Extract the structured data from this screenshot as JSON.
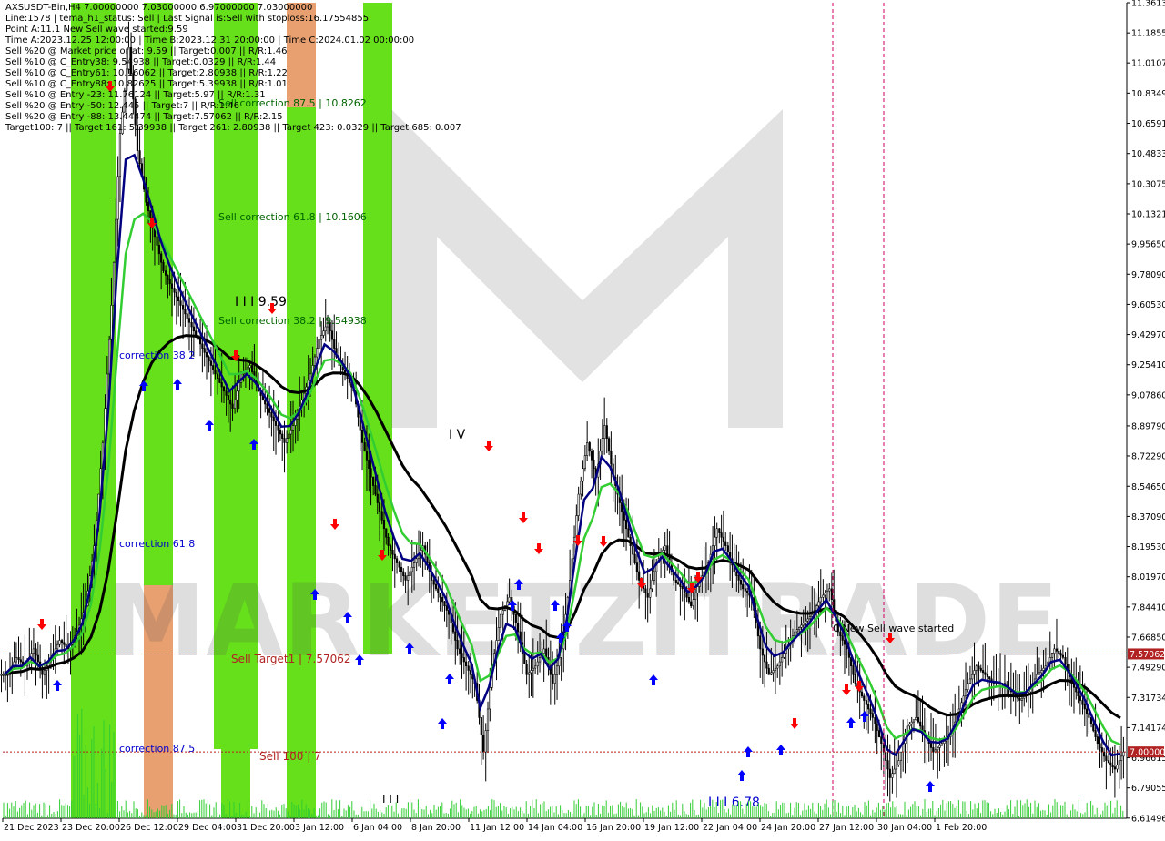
{
  "info_lines": [
    "AXSUSDT-Bin,H4  7.00000000 7.03000000 6.97000000 7.03000000",
    "Line:1578 | tema_h1_status: Sell | Last Signal is:Sell with stoploss:16.17554855",
    "Point A:11.1 New Sell wave started:9.59",
    "Time A:2023.12.25 12:00:00 | Time B:2023.12.31 20:00:00 | Time C:2024.01.02 00:00:00",
    "Sell %20 @ Market price or at: 9.59 || Target:0.007 || R/R:1.46",
    "Sell %10 @ C_Entry38: 9.54938 || Target:0.0329 || R/R:1.44",
    "Sell %10 @ C_Entry61: 10.16062 || Target:2.80938 || R/R:1.22",
    "Sell %10 @ C_Entry88: 10.82625 || Target:5.39938 || R/R:1.01",
    "Sell %10 @ Entry -23: 11.76124 || Target:5.97 || R/R:1.31",
    "Sell %20 @ Entry -50: 12.445 || Target:7 || R/R:1.46",
    "Sell %20 @ Entry -88: 13.44474 || Target:7.57062 || R/R:2.15",
    "Target100: 7 || Target 161: 5.39938 || Target 261: 2.80938 || Target 423: 0.0329 || Target 685: 0.007"
  ],
  "watermark": "MARKETZITRADE",
  "chart_data": {
    "type": "candlestick",
    "symbol": "AXSUSDT-Bin",
    "timeframe": "H4",
    "ylim": [
      6.614,
      11.3613
    ],
    "y_ticks": [
      "11.36130",
      "11.18550",
      "11.01071",
      "10.83490",
      "10.65910",
      "10.48330",
      "10.30750",
      "10.13210",
      "9.95650",
      "9.78090",
      "9.60530",
      "9.42970",
      "9.25410",
      "9.07860",
      "8.89790",
      "8.72290",
      "8.54650",
      "8.37090",
      "8.19530",
      "8.01970",
      "7.84410",
      "7.66850",
      "7.49290",
      "7.31734",
      "7.14174",
      "6.96615",
      "6.79055",
      "6.61496"
    ],
    "x_ticks": [
      "21 Dec 2023",
      "23 Dec 20:00",
      "26 Dec 12:00",
      "29 Dec 04:00",
      "31 Dec 20:00",
      "3 Jan 12:00",
      "6 Jan 04:00",
      "8 Jan 20:00",
      "11 Jan 12:00",
      "14 Jan 04:00",
      "16 Jan 20:00",
      "19 Jan 12:00",
      "22 Jan 04:00",
      "24 Jan 20:00",
      "27 Jan 12:00",
      "30 Jan 04:00",
      "1 Feb 20:00"
    ],
    "close_trajectory": [
      7.45,
      7.55,
      7.5,
      7.6,
      7.45,
      7.55,
      7.65,
      7.6,
      7.7,
      7.85,
      8.2,
      8.8,
      9.6,
      10.6,
      11.1,
      10.5,
      10.2,
      10.0,
      9.8,
      9.7,
      9.6,
      9.5,
      9.4,
      9.3,
      9.2,
      9.1,
      9.0,
      9.2,
      9.25,
      9.1,
      9.0,
      8.9,
      8.8,
      8.9,
      9.05,
      9.2,
      9.4,
      9.5,
      9.3,
      9.2,
      9.1,
      8.8,
      8.6,
      8.4,
      8.2,
      8.1,
      8.0,
      8.1,
      8.2,
      8.0,
      7.9,
      7.8,
      7.6,
      7.5,
      7.4,
      7.0,
      7.5,
      7.8,
      7.9,
      7.7,
      7.45,
      7.5,
      7.6,
      7.4,
      7.6,
      8.0,
      8.5,
      8.8,
      8.6,
      8.9,
      8.6,
      8.4,
      8.2,
      8.0,
      7.9,
      8.1,
      8.2,
      8.0,
      7.95,
      7.85,
      8.0,
      8.1,
      8.3,
      8.2,
      8.05,
      7.95,
      7.9,
      7.6,
      7.45,
      7.5,
      7.6,
      7.7,
      7.75,
      7.8,
      7.9,
      7.95,
      7.7,
      7.6,
      7.4,
      7.3,
      7.2,
      7.05,
      6.85,
      6.95,
      7.15,
      7.2,
      7.1,
      7.0,
      7.05,
      7.1,
      7.25,
      7.4,
      7.5,
      7.45,
      7.4,
      7.4,
      7.35,
      7.3,
      7.35,
      7.45,
      7.5,
      7.6,
      7.55,
      7.4,
      7.3,
      7.2,
      7.05,
      6.95,
      6.9,
      7.0
    ],
    "indicators": [
      {
        "name": "EMA dark blue",
        "color": "#000080"
      },
      {
        "name": "EMA green",
        "color": "#32cd32"
      },
      {
        "name": "EMA black",
        "color": "#000000"
      }
    ],
    "levels": [
      {
        "label": "Sell Target1 | 7.57062",
        "value": 7.57062,
        "color": "#b22222"
      },
      {
        "label": "Sell 100 | 7",
        "value": 7.0,
        "color": "#b22222"
      }
    ],
    "price_tags": [
      {
        "text": "7.57062",
        "value": 7.57062,
        "bg": "#b22222"
      },
      {
        "text": "7.00000",
        "value": 7.0,
        "bg": "#b22222"
      }
    ],
    "annotations": [
      {
        "text": "Sell correction 87.5 | 10.8262",
        "color": "#006400"
      },
      {
        "text": "Sell correction 61.8 | 10.1606",
        "color": "#006400"
      },
      {
        "text": "Sell correction 38.2 | 9.54938",
        "color": "#006400"
      },
      {
        "text": "correction 38.2",
        "color": "#0000cd"
      },
      {
        "text": "correction 61.8",
        "color": "#0000cd"
      },
      {
        "text": "correction 87.5",
        "color": "#0000cd"
      },
      {
        "text": "I I I 9.59",
        "color": "#000000"
      },
      {
        "text": "I V",
        "color": "#000000"
      },
      {
        "text": "I I I 6.78",
        "color": "#0000cd"
      },
      {
        "text": "0 New Sell wave started",
        "color": "#000000"
      },
      {
        "text": "I I I",
        "color": "#000000"
      }
    ],
    "vertical_markers": [
      "27 Jan 12:00 area",
      "30 Jan 04:00 area"
    ],
    "colors": {
      "bull": "#000000",
      "bear": "#000000",
      "zone_green": "#66e01a",
      "zone_orange": "#e8a070",
      "marker_red": "#ff0000",
      "marker_blue": "#0000ff"
    }
  }
}
